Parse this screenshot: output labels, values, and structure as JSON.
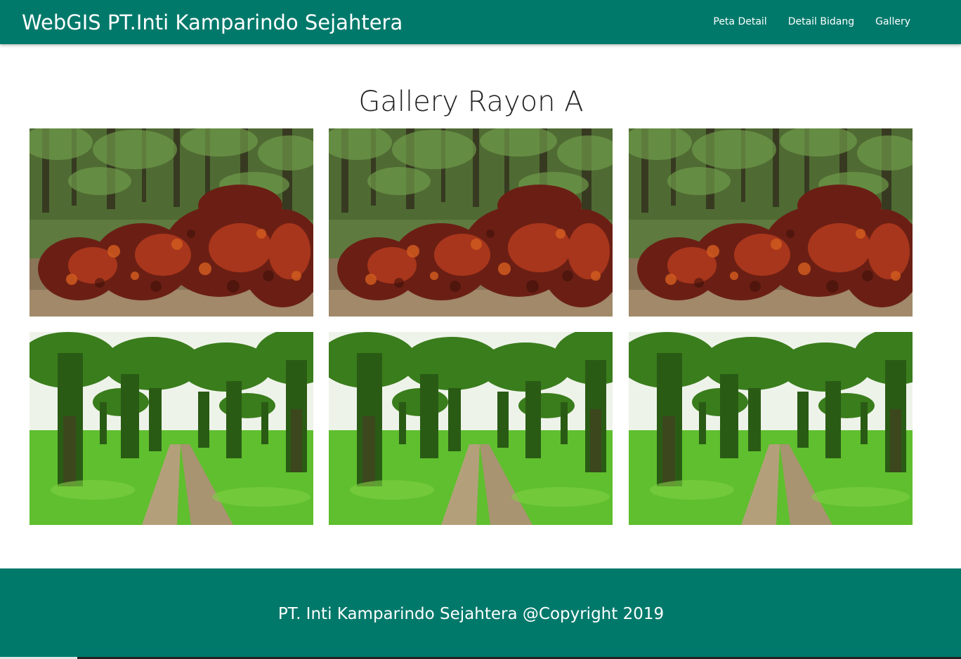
{
  "navbar": {
    "brand": "WebGIS PT.Inti Kamparindo Sejahtera",
    "links": [
      "Peta Detail",
      "Detail Bidang",
      "Gallery"
    ],
    "color": "#00796b"
  },
  "main": {
    "title": "Gallery Rayon A",
    "photos": [
      {
        "subject": "palm-fruit-bunches"
      },
      {
        "subject": "palm-fruit-bunches"
      },
      {
        "subject": "palm-fruit-bunches"
      },
      {
        "subject": "palm-plantation-path"
      },
      {
        "subject": "palm-plantation-path"
      },
      {
        "subject": "palm-plantation-path"
      }
    ]
  },
  "footer": {
    "text": "PT. Inti Kamparindo Sejahtera @Copyright 2019",
    "color": "#00796b"
  }
}
